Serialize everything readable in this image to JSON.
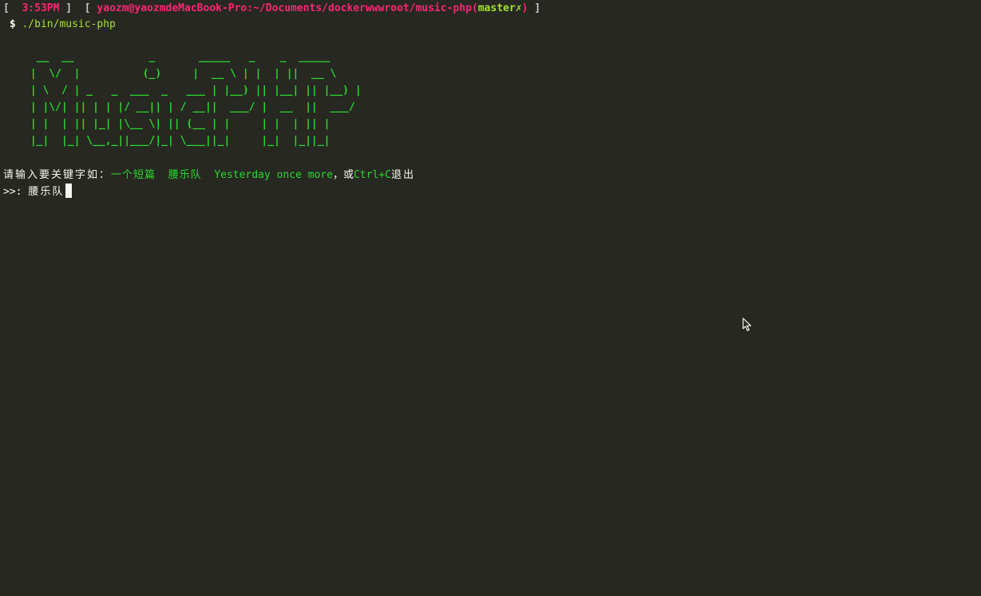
{
  "statusline": {
    "open_bracket": "[",
    "time": "3:53PM",
    "close_bracket_1": "]",
    "open_bracket_2": "[",
    "user_path": "yaozm@yaozmdeMacBook-Pro:~/Documents/dockerwwwroot/music-php",
    "branch_open": "(",
    "branch": "master✗",
    "branch_close": ")",
    "close_bracket_2": "]"
  },
  "command": {
    "prompt_symbol": "$",
    "text": "./bin/music-php"
  },
  "banner": {
    "lines": [
      "  __  __            _       _____   _    _  _____ ",
      " |  \\/  |          (_)     |  __ \\ | |  | ||  __ \\",
      " | \\  / | _   _  ___  _   ___ | |__) || |__| || |__) |",
      " | |\\/| || | | |/ __|| | / __||  ___/ |  __  ||  ___/",
      " | |  | || |_| |\\__ \\| || (__ | |     | |  | || |",
      " |_|  |_| \\__,_||___/|_| \\___||_|     |_|  |_||_|"
    ]
  },
  "prompt": {
    "label": "请输入要关键字如：",
    "example_1": "一个短篇",
    "example_2": "腰乐队",
    "example_3": "Yesterday once more",
    "separator": "，或",
    "ctrl": "Ctrl+C",
    "exit": "退出"
  },
  "input": {
    "prefix": ">>:",
    "value": "腰乐队"
  },
  "colors": {
    "background": "#272822",
    "green": "#29d92f",
    "pink": "#f92672"
  }
}
